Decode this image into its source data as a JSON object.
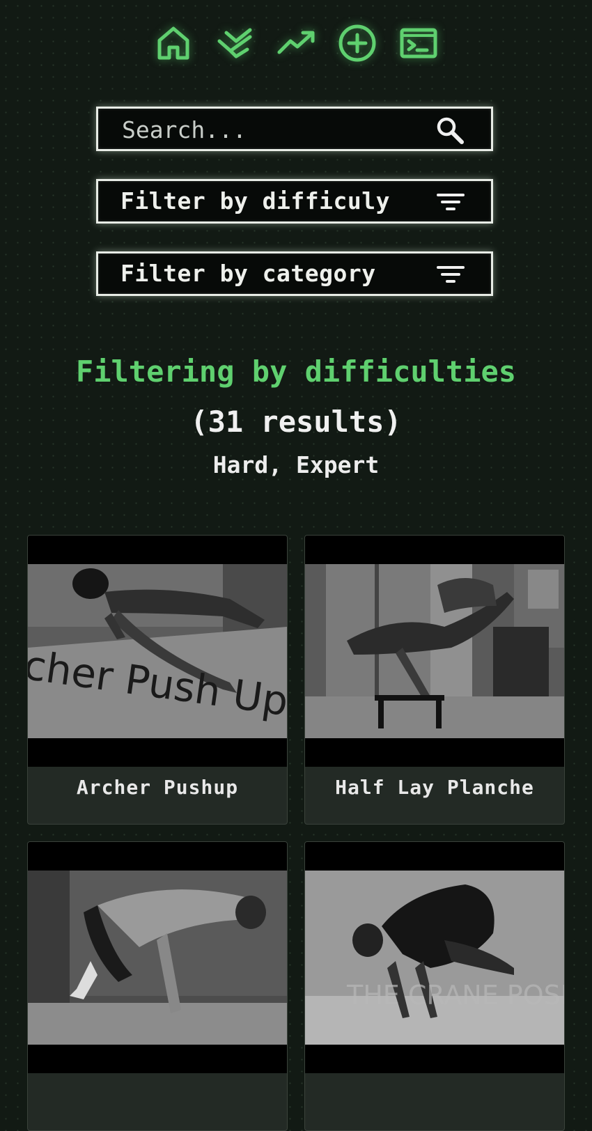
{
  "nav": {
    "items": [
      {
        "icon": "home-icon"
      },
      {
        "icon": "workouts-icon"
      },
      {
        "icon": "progress-icon"
      },
      {
        "icon": "add-icon"
      },
      {
        "icon": "terminal-icon"
      }
    ],
    "accent_color": "#5fd06f"
  },
  "search": {
    "placeholder": "Search...",
    "value": ""
  },
  "filters": {
    "difficulty_label": "Filter by difficuly",
    "category_label": "Filter by category"
  },
  "results": {
    "prefix": "Filtering by difficulties",
    "count_text": "(31 results)",
    "selected": "Hard, Expert"
  },
  "exercises": [
    {
      "title": "Archer Pushup",
      "overlay_text": "cher Push Ups"
    },
    {
      "title": "Half Lay Planche"
    },
    {
      "title": ""
    },
    {
      "title": "",
      "overlay_text": "THE CRANE POSE"
    }
  ]
}
